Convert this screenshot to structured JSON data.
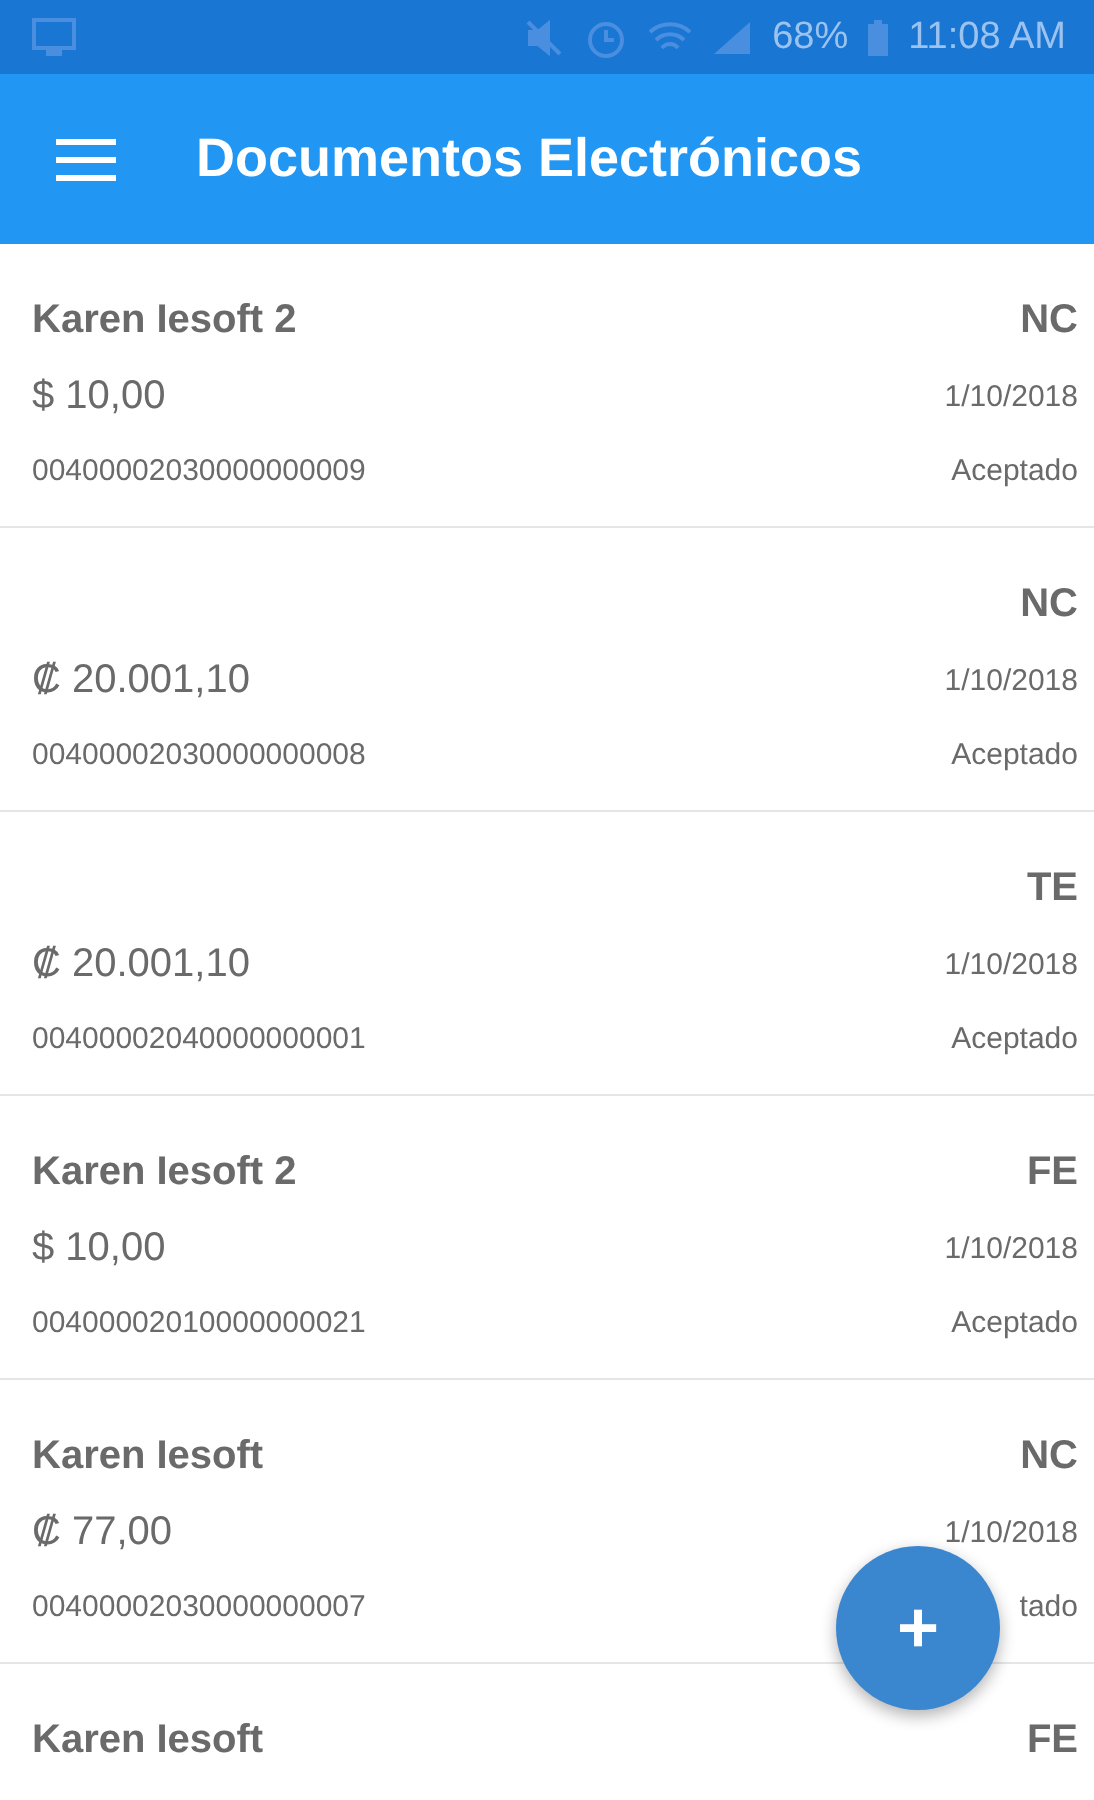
{
  "status_bar": {
    "battery": "68%",
    "time": "11:08 AM"
  },
  "app_bar": {
    "title": "Documentos Electrónicos"
  },
  "documents": [
    {
      "name": "Karen Iesoft 2",
      "type": "NC",
      "amount": "$ 10,00",
      "date": "1/10/2018",
      "number": "00400002030000000009",
      "status": "Aceptado"
    },
    {
      "type": "NC",
      "amount": "₡ 20.001,10",
      "date": "1/10/2018",
      "number": "00400002030000000008",
      "status": "Aceptado"
    },
    {
      "type": "TE",
      "amount": "₡ 20.001,10",
      "date": "1/10/2018",
      "number": "00400002040000000001",
      "status": "Aceptado"
    },
    {
      "name": "Karen Iesoft 2",
      "type": "FE",
      "amount": "$ 10,00",
      "date": "1/10/2018",
      "number": "00400002010000000021",
      "status": "Aceptado"
    },
    {
      "name": "Karen Iesoft",
      "type": "NC",
      "amount": "₡ 77,00",
      "date": "1/10/2018",
      "number": "00400002030000000007",
      "status": "tado"
    },
    {
      "name": "Karen Iesoft",
      "type": "FE"
    }
  ],
  "fab": {
    "label": "+"
  }
}
